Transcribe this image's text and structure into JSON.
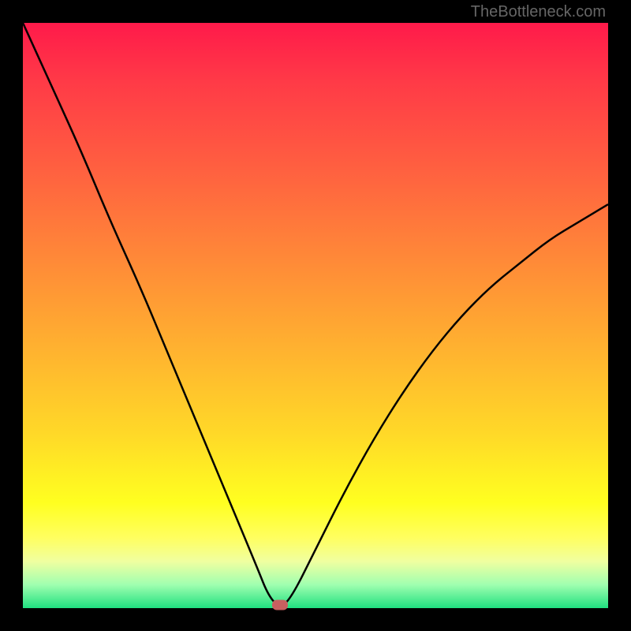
{
  "watermark": "TheBottleneck.com",
  "chart_data": {
    "type": "line",
    "title": "",
    "xlabel": "",
    "ylabel": "",
    "xlim": [
      0,
      100
    ],
    "ylim": [
      0,
      100
    ],
    "series": [
      {
        "name": "bottleneck-curve",
        "x": [
          0,
          5,
          10,
          15,
          20,
          25,
          30,
          35,
          40,
          42,
          44,
          46,
          50,
          55,
          60,
          65,
          70,
          75,
          80,
          85,
          90,
          95,
          100
        ],
        "values": [
          100,
          89,
          78,
          66,
          55,
          43,
          31,
          19,
          7,
          2,
          0,
          2,
          10,
          20,
          29,
          37,
          44,
          50,
          55,
          59,
          63,
          66,
          69
        ]
      }
    ],
    "marker": {
      "x": 44,
      "y": 0
    },
    "gradient_bands": [
      {
        "pos": 0,
        "color": "#ff1a4a"
      },
      {
        "pos": 82,
        "color": "#ffff20"
      },
      {
        "pos": 100,
        "color": "#20e080"
      }
    ]
  }
}
